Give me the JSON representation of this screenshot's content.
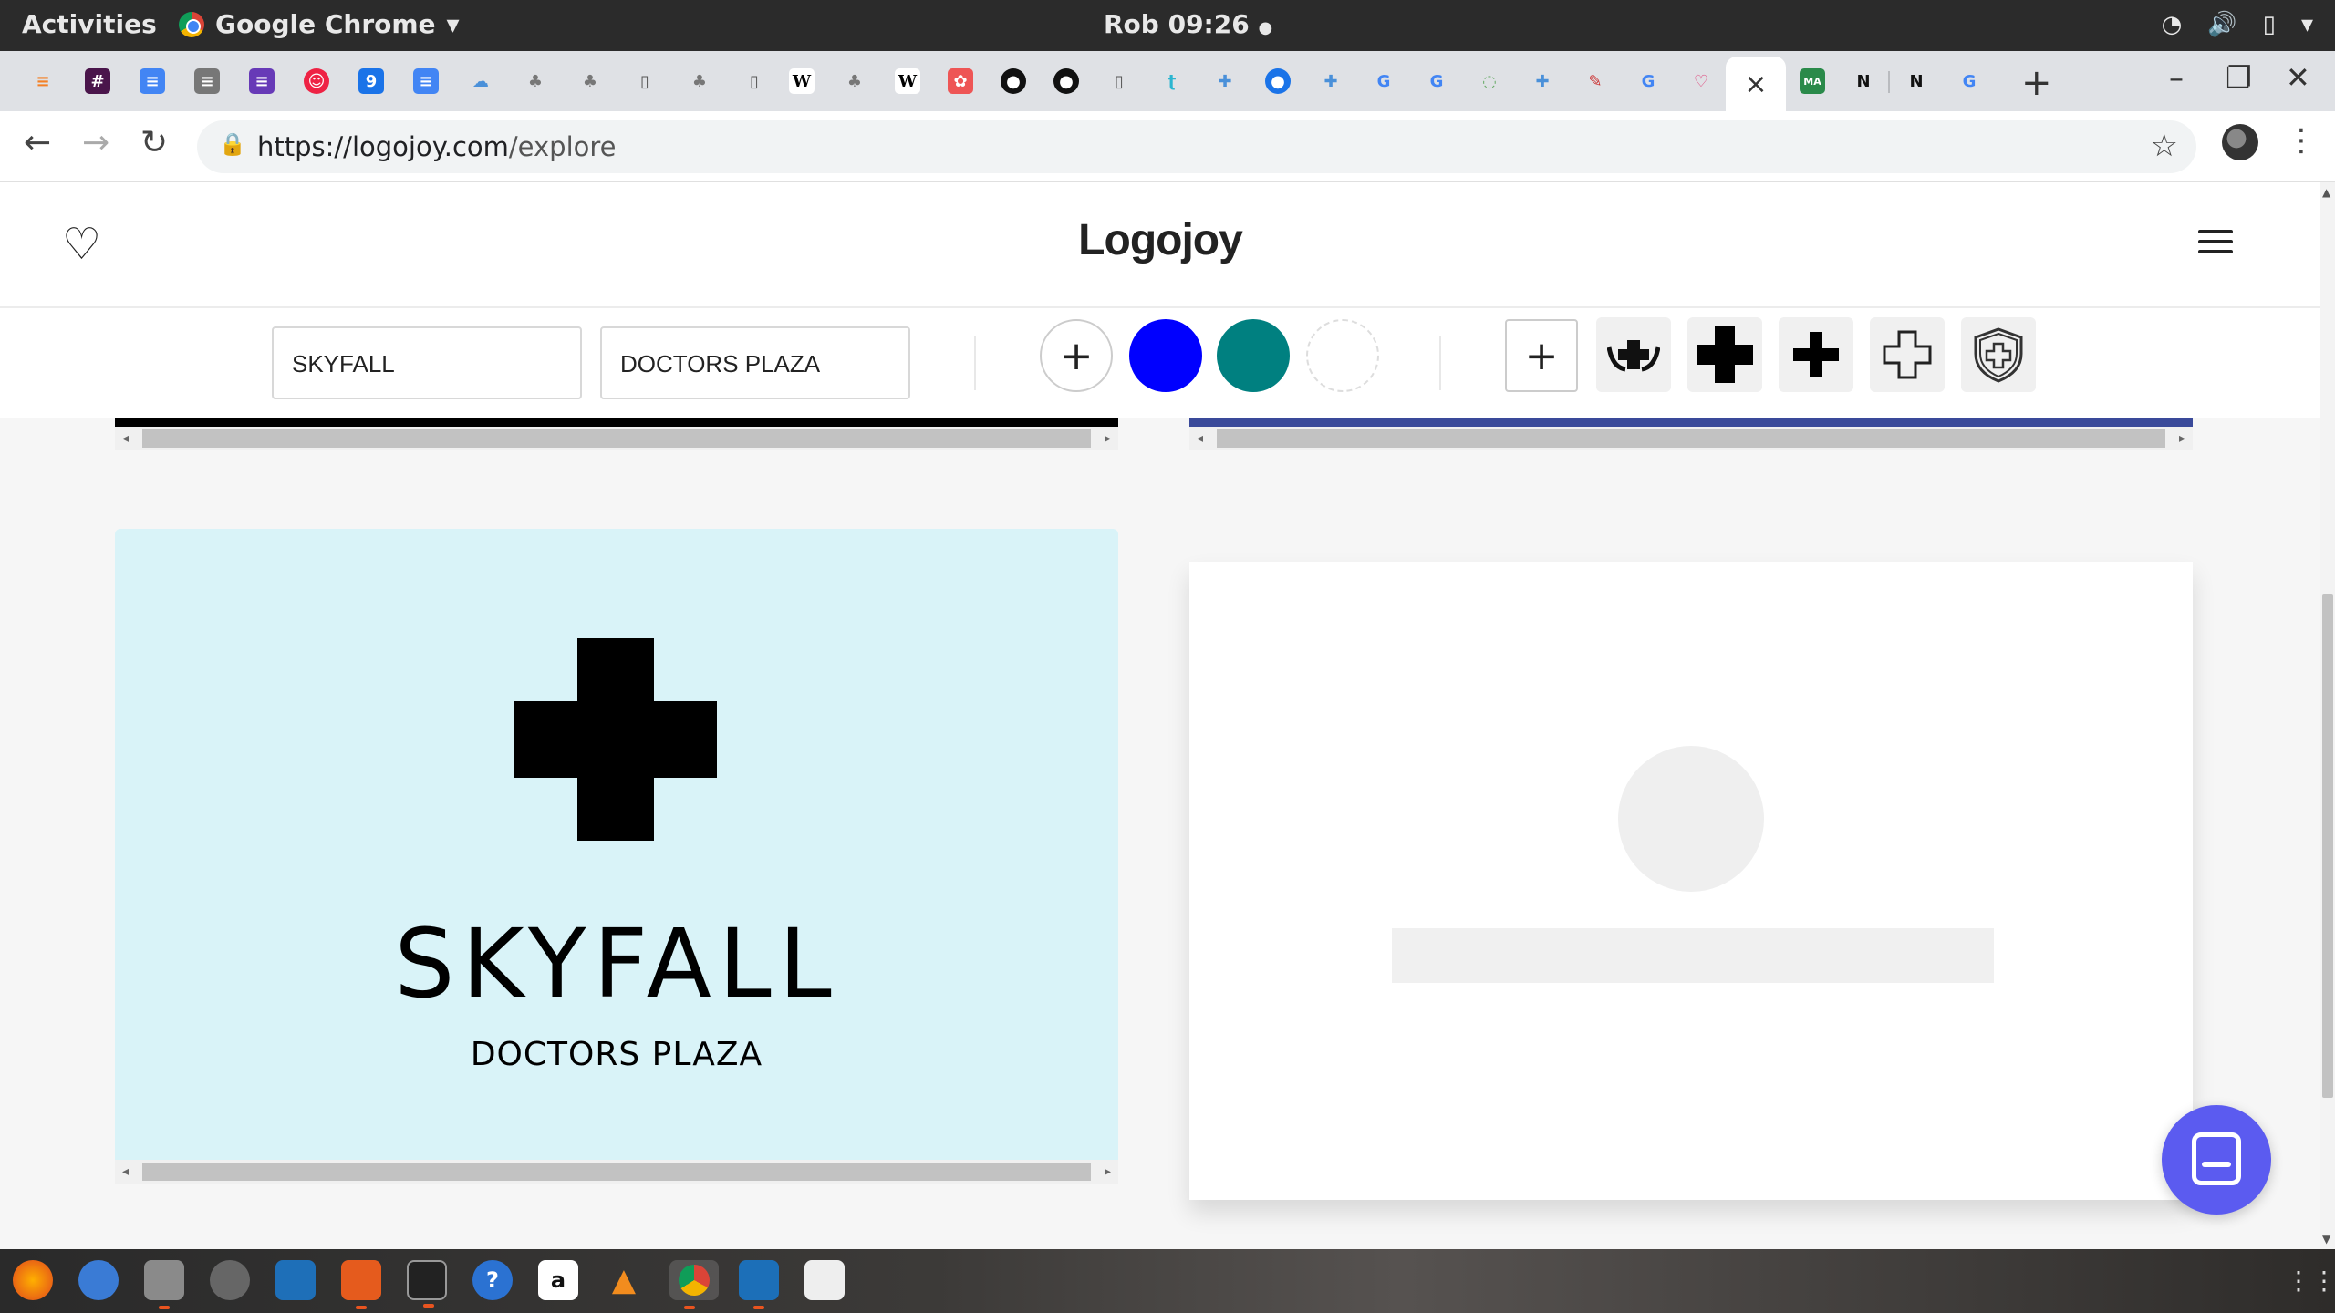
{
  "topbar": {
    "activities": "Activities",
    "app_name": "Google Chrome",
    "clock": "Rob 09:26",
    "status_dot": "●"
  },
  "browser": {
    "url_host": "https://logojoy.com",
    "url_path": "/explore",
    "active_tab_close": "×",
    "new_tab": "+",
    "favicon_labels": {
      "calendar": "9",
      "wikipedia_1": "W",
      "wikipedia_2": "W",
      "google": "G",
      "notion_1": "N",
      "notion_2": "N"
    }
  },
  "header": {
    "brand": "Logojoy"
  },
  "controls": {
    "company_name": "SKYFALL",
    "slogan": "DOCTORS PLAZA",
    "colors": [
      "#0000ff",
      "#008080",
      "#ffffff"
    ],
    "add_symbol": "+"
  },
  "logo_preview": {
    "name": "SKYFALL",
    "tagline": "DOCTORS PLAZA",
    "background": "#d9f3f8",
    "icon": "medical-cross-icon"
  },
  "dock": {
    "amazon_label": "a",
    "help_label": "?"
  }
}
